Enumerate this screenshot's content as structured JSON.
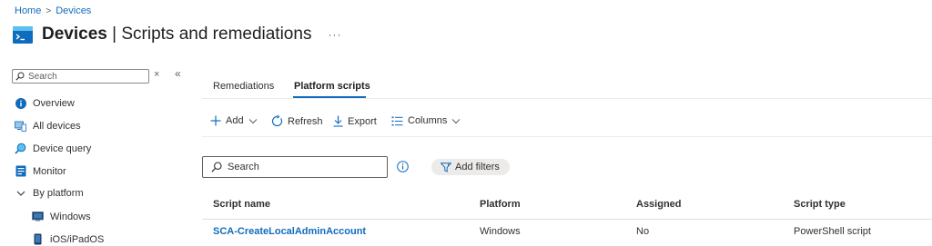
{
  "breadcrumb": {
    "home": "Home",
    "separator": ">",
    "current": "Devices"
  },
  "header": {
    "title_bold": "Devices",
    "title_separator": " | ",
    "title_rest": "Scripts and remediations",
    "more": "···"
  },
  "sidebar": {
    "search_placeholder": "Search",
    "close_glyph": "×",
    "collapse_glyph": "«",
    "items": [
      {
        "label": "Overview",
        "icon": "info-icon"
      },
      {
        "label": "All devices",
        "icon": "devices-icon"
      },
      {
        "label": "Device query",
        "icon": "device-query-icon"
      },
      {
        "label": "Monitor",
        "icon": "monitor-icon"
      },
      {
        "label": "By platform",
        "icon": "chevron-down-icon"
      },
      {
        "label": "Windows",
        "icon": "windows-icon"
      },
      {
        "label": "iOS/iPadOS",
        "icon": "phone-icon"
      }
    ]
  },
  "tabs": [
    {
      "label": "Remediations",
      "active": false
    },
    {
      "label": "Platform scripts",
      "active": true
    }
  ],
  "toolbar": {
    "add": "Add",
    "refresh": "Refresh",
    "export": "Export",
    "columns": "Columns"
  },
  "search": {
    "placeholder": "Search"
  },
  "filters": {
    "label": "Add filters"
  },
  "table": {
    "columns": [
      "Script name",
      "Platform",
      "Assigned",
      "Script type"
    ],
    "rows": [
      [
        "SCA-CreateLocalAdminAccount",
        "Windows",
        "No",
        "PowerShell script"
      ]
    ]
  },
  "colors": {
    "accent": "#0f6cbd",
    "text": "#323130",
    "border": "#edebe9"
  }
}
